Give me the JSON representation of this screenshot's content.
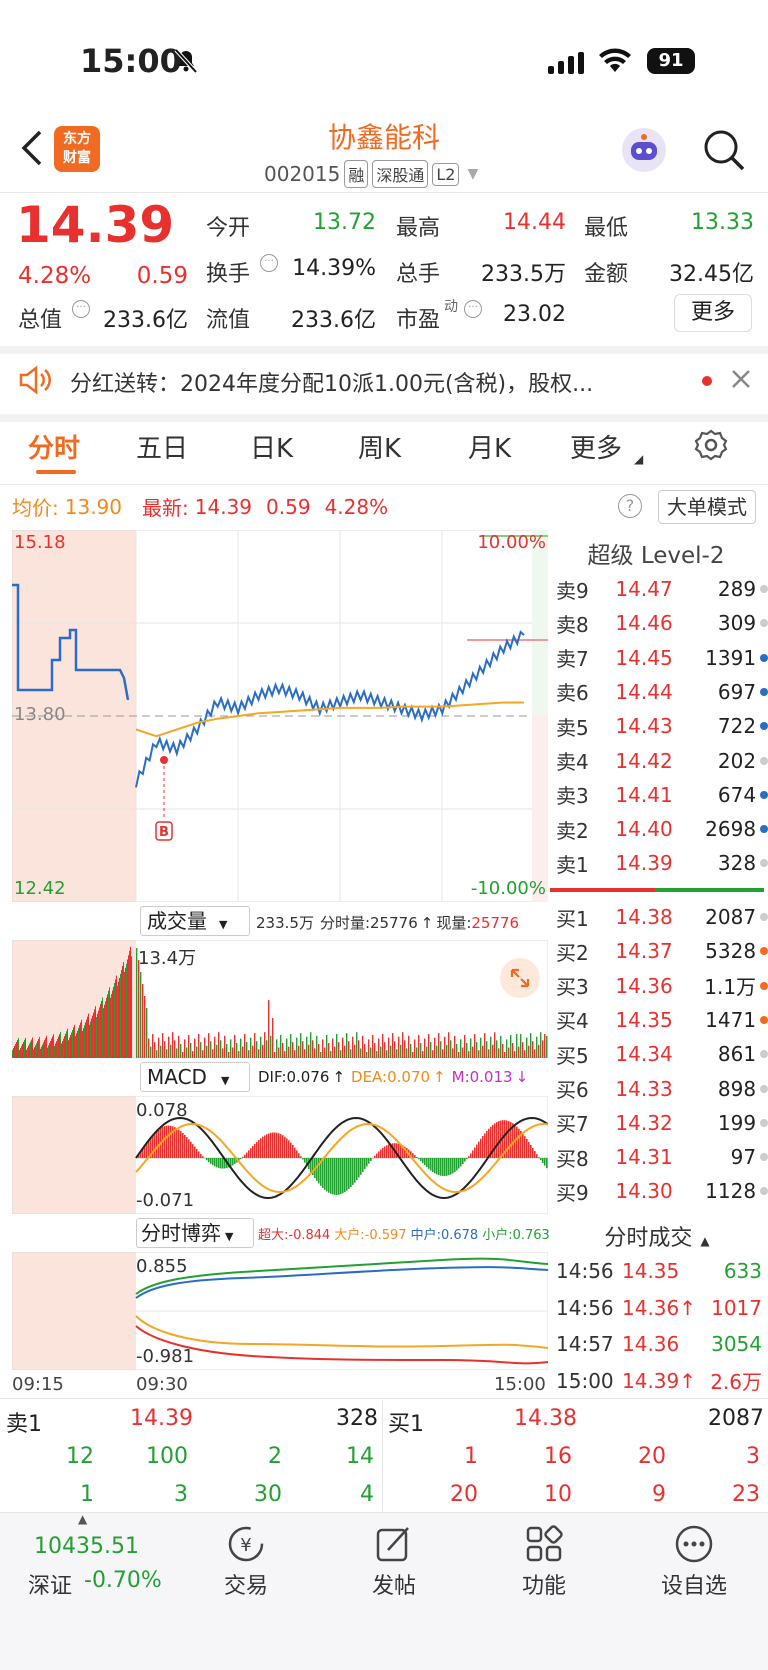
{
  "status_bar": {
    "time": "15:00",
    "battery": "91"
  },
  "header": {
    "title": "协鑫能科",
    "code": "002015",
    "tags": [
      "融",
      "深股通",
      "L2"
    ],
    "logo_line1": "东方",
    "logo_line2": "财富"
  },
  "quote": {
    "price": "14.39",
    "pct": "4.28%",
    "chg": "0.59",
    "fields": [
      {
        "label": "今开",
        "value": "13.72",
        "color": "green"
      },
      {
        "label": "最高",
        "value": "14.44",
        "color": "red"
      },
      {
        "label": "最低",
        "value": "13.33",
        "color": "green"
      },
      {
        "label": "换手",
        "value": "14.39%",
        "color": "dark"
      },
      {
        "label": "总手",
        "value": "233.5万",
        "color": "dark"
      },
      {
        "label": "金额",
        "value": "32.45亿",
        "color": "dark"
      },
      {
        "label": "总值",
        "value": "233.6亿",
        "color": "dark"
      },
      {
        "label": "流值",
        "value": "233.6亿",
        "color": "dark"
      },
      {
        "label": "市盈",
        "value": "23.02",
        "color": "dark"
      }
    ],
    "pe_sup": "动",
    "more": "更多"
  },
  "notice": "分红送转：2024年度分配10派1.00元(含税)，股权...",
  "tabs": [
    "分时",
    "五日",
    "日K",
    "周K",
    "月K",
    "更多"
  ],
  "info_bar": {
    "avg_label": "均价:",
    "avg": "13.90",
    "latest_label": "最新:",
    "latest": "14.39",
    "chg": "0.59",
    "pct": "4.28%",
    "mode": "大单模式"
  },
  "chart": {
    "y_top": "15.18",
    "y_mid": "13.80",
    "y_bot": "12.42",
    "pct_top": "10.00%",
    "pct_bot": "-10.00%",
    "t_start": "09:15",
    "t_mid": "09:30",
    "t_end": "15:00"
  },
  "chart_data": {
    "type": "line",
    "series": [
      {
        "values": [
          13.3,
          13.6,
          13.55,
          13.7,
          13.9,
          13.85,
          13.95,
          14.0,
          13.95,
          13.85,
          13.9,
          13.95,
          13.9,
          13.85,
          13.8,
          13.85,
          14.0,
          14.15,
          14.3,
          14.4
        ]
      },
      {
        "values": [
          13.7,
          13.65,
          13.7,
          13.75,
          13.78,
          13.8,
          13.82,
          13.83,
          13.84,
          13.85,
          13.86,
          13.86,
          13.86,
          13.87,
          13.87,
          13.87,
          13.88,
          13.89,
          13.9,
          13.9
        ]
      }
    ]
  },
  "volume": {
    "label": "成交量",
    "total": "233.5万",
    "fen_label": "分时量:",
    "fen": "25776",
    "xian_label": "现量:",
    "xian": "25776",
    "peak": "13.4万"
  },
  "macd": {
    "label": "MACD",
    "dif": "DIF:0.076",
    "dea": "DEA:0.070",
    "m": "M:0.013",
    "top": "0.078",
    "bot": "-0.071"
  },
  "game": {
    "label": "分时博弈",
    "super": "超大:-0.844",
    "big": "大户:-0.597",
    "mid": "中户:0.678",
    "small": "小户:0.763",
    "top": "0.855",
    "bot": "-0.981"
  },
  "orderbook": {
    "title": "超级 Level-2",
    "asks": [
      {
        "l": "卖9",
        "p": "14.47",
        "v": "289"
      },
      {
        "l": "卖8",
        "p": "14.46",
        "v": "309"
      },
      {
        "l": "卖7",
        "p": "14.45",
        "v": "1391"
      },
      {
        "l": "卖6",
        "p": "14.44",
        "v": "697"
      },
      {
        "l": "卖5",
        "p": "14.43",
        "v": "722"
      },
      {
        "l": "卖4",
        "p": "14.42",
        "v": "202"
      },
      {
        "l": "卖3",
        "p": "14.41",
        "v": "674"
      },
      {
        "l": "卖2",
        "p": "14.40",
        "v": "2698"
      },
      {
        "l": "卖1",
        "p": "14.39",
        "v": "328"
      }
    ],
    "bids": [
      {
        "l": "买1",
        "p": "14.38",
        "v": "2087"
      },
      {
        "l": "买2",
        "p": "14.37",
        "v": "5328"
      },
      {
        "l": "买3",
        "p": "14.36",
        "v": "1.1万"
      },
      {
        "l": "买4",
        "p": "14.35",
        "v": "1471"
      },
      {
        "l": "买5",
        "p": "14.34",
        "v": "861"
      },
      {
        "l": "买6",
        "p": "14.33",
        "v": "898"
      },
      {
        "l": "买7",
        "p": "14.32",
        "v": "199"
      },
      {
        "l": "买8",
        "p": "14.31",
        "v": "97"
      },
      {
        "l": "买9",
        "p": "14.30",
        "v": "1128"
      }
    ]
  },
  "trades": {
    "title": "分时成交",
    "rows": [
      {
        "t": "14:56",
        "p": "14.35",
        "v": "633"
      },
      {
        "t": "14:56",
        "p": "14.36↑",
        "v": "1017"
      },
      {
        "t": "14:57",
        "p": "14.36",
        "v": "3054"
      },
      {
        "t": "15:00",
        "p": "14.39↑",
        "v": "2.6万"
      }
    ]
  },
  "bottom_book": {
    "ask_label": "卖1",
    "ask_price": "14.39",
    "ask_vol": "328",
    "bid_label": "买1",
    "bid_price": "14.38",
    "bid_vol": "2087",
    "ask_row1": [
      "12",
      "100",
      "2",
      "14"
    ],
    "ask_row2": [
      "1",
      "3",
      "30",
      "4"
    ],
    "bid_row1": [
      "1",
      "16",
      "20",
      "3"
    ],
    "bid_row2": [
      "20",
      "10",
      "9",
      "23"
    ]
  },
  "nav": {
    "index_value": "10435.51",
    "index_name": "深证",
    "index_chg": "-0.70%",
    "items": [
      "交易",
      "发帖",
      "功能",
      "设自选"
    ]
  }
}
